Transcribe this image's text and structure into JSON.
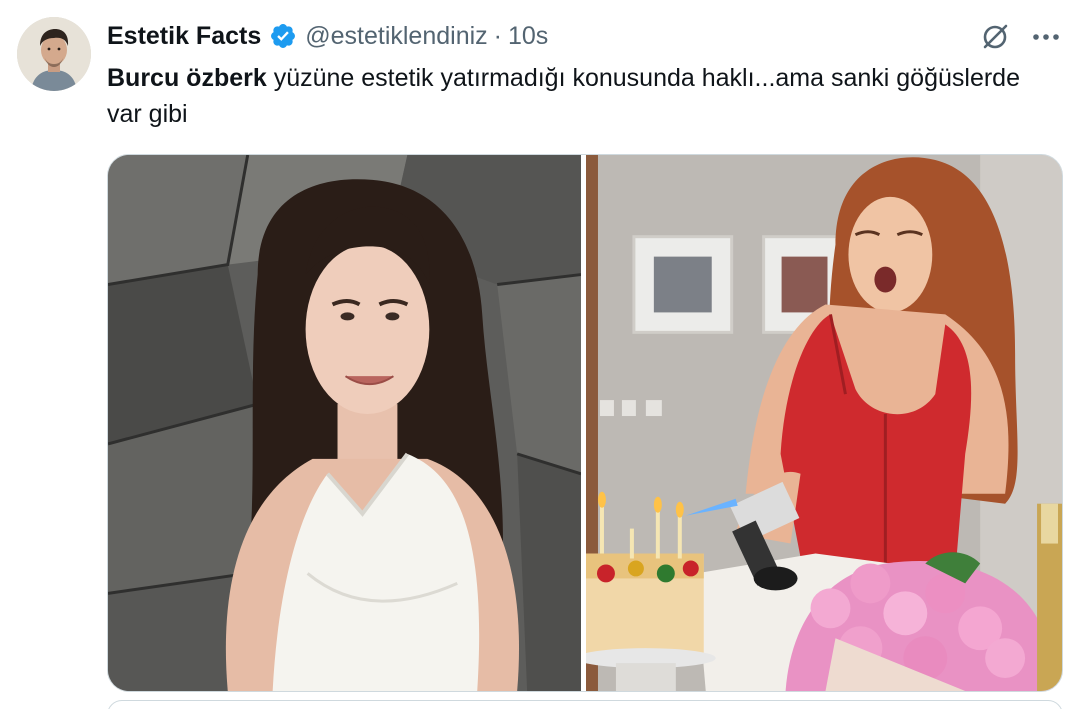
{
  "tweet": {
    "author": {
      "display_name": "Estetik Facts",
      "handle": "@estetiklendiniz",
      "separator": "·",
      "time": "10s",
      "verified_icon": "verified-badge-icon"
    },
    "text": {
      "bold_part": "Burcu özberk",
      "rest": " yüzüne estetik yatırmadığı konusunda haklı...ama sanki göğüslerde var gibi"
    },
    "actions": {
      "grok_icon": "grok-icon",
      "more_icon": "more-dots-icon"
    },
    "media": {
      "count": 2
    }
  },
  "colors": {
    "text_primary": "#0f1419",
    "text_secondary": "#536471",
    "verified_blue": "#1d9bf0",
    "border": "#cfd9de"
  }
}
